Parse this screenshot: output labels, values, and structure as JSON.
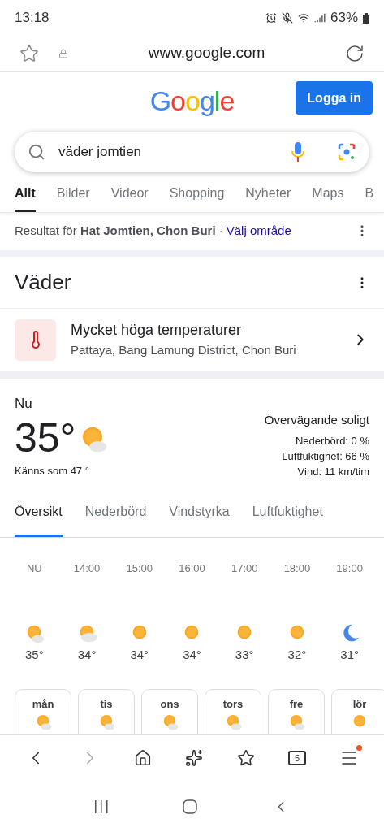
{
  "status_bar": {
    "time": "13:18",
    "battery": "63%"
  },
  "url_bar": {
    "url": "www.google.com"
  },
  "header": {
    "logo": "Google",
    "login": "Logga in"
  },
  "search": {
    "value": "väder jomtien"
  },
  "tabs": [
    {
      "label": "Allt",
      "selected": true
    },
    {
      "label": "Bilder",
      "selected": false
    },
    {
      "label": "Videor",
      "selected": false
    },
    {
      "label": "Shopping",
      "selected": false
    },
    {
      "label": "Nyheter",
      "selected": false
    },
    {
      "label": "Maps",
      "selected": false
    },
    {
      "label": "B",
      "selected": false
    }
  ],
  "location": {
    "text": "Resultat för **Hat Jomtien, Chon Buri** ·",
    "link": "Välj område"
  },
  "weather": {
    "title": "Väder",
    "alert": {
      "title": "Mycket höga temperaturer",
      "place": "Pattaya, Bang Lamung District, Chon Buri"
    },
    "now_label": "Nu",
    "temp": "35°",
    "kind": "partly",
    "feels": "Känns som 47 °",
    "condition": "Övervägande soligt",
    "details": [
      "Nederbörd: 0 %",
      "Luftfuktighet: 66 %",
      "Vind: 11 km/tim"
    ],
    "tabs": [
      {
        "label": "Översikt",
        "selected": true
      },
      {
        "label": "Nederbörd",
        "selected": false
      },
      {
        "label": "Vindstyrka",
        "selected": false
      },
      {
        "label": "Luftfuktighet",
        "selected": false
      }
    ],
    "hours": [
      {
        "time": "NU",
        "kind": "partly",
        "temp": "35°"
      },
      {
        "time": "14:00",
        "kind": "cloudy",
        "temp": "34°"
      },
      {
        "time": "15:00",
        "kind": "sun",
        "temp": "34°"
      },
      {
        "time": "16:00",
        "kind": "sun",
        "temp": "34°"
      },
      {
        "time": "17:00",
        "kind": "sun",
        "temp": "33°"
      },
      {
        "time": "18:00",
        "kind": "sun",
        "temp": "32°"
      },
      {
        "time": "19:00",
        "kind": "moon",
        "temp": "31°"
      }
    ],
    "days": [
      {
        "day": "mån",
        "kind": "partly"
      },
      {
        "day": "tis",
        "kind": "partly"
      },
      {
        "day": "ons",
        "kind": "partly"
      },
      {
        "day": "tors",
        "kind": "partly"
      },
      {
        "day": "fre",
        "kind": "partly"
      },
      {
        "day": "lör",
        "kind": "sun"
      }
    ]
  },
  "bottom_nav": {
    "tab_count": "5",
    "menu_badge": true
  }
}
